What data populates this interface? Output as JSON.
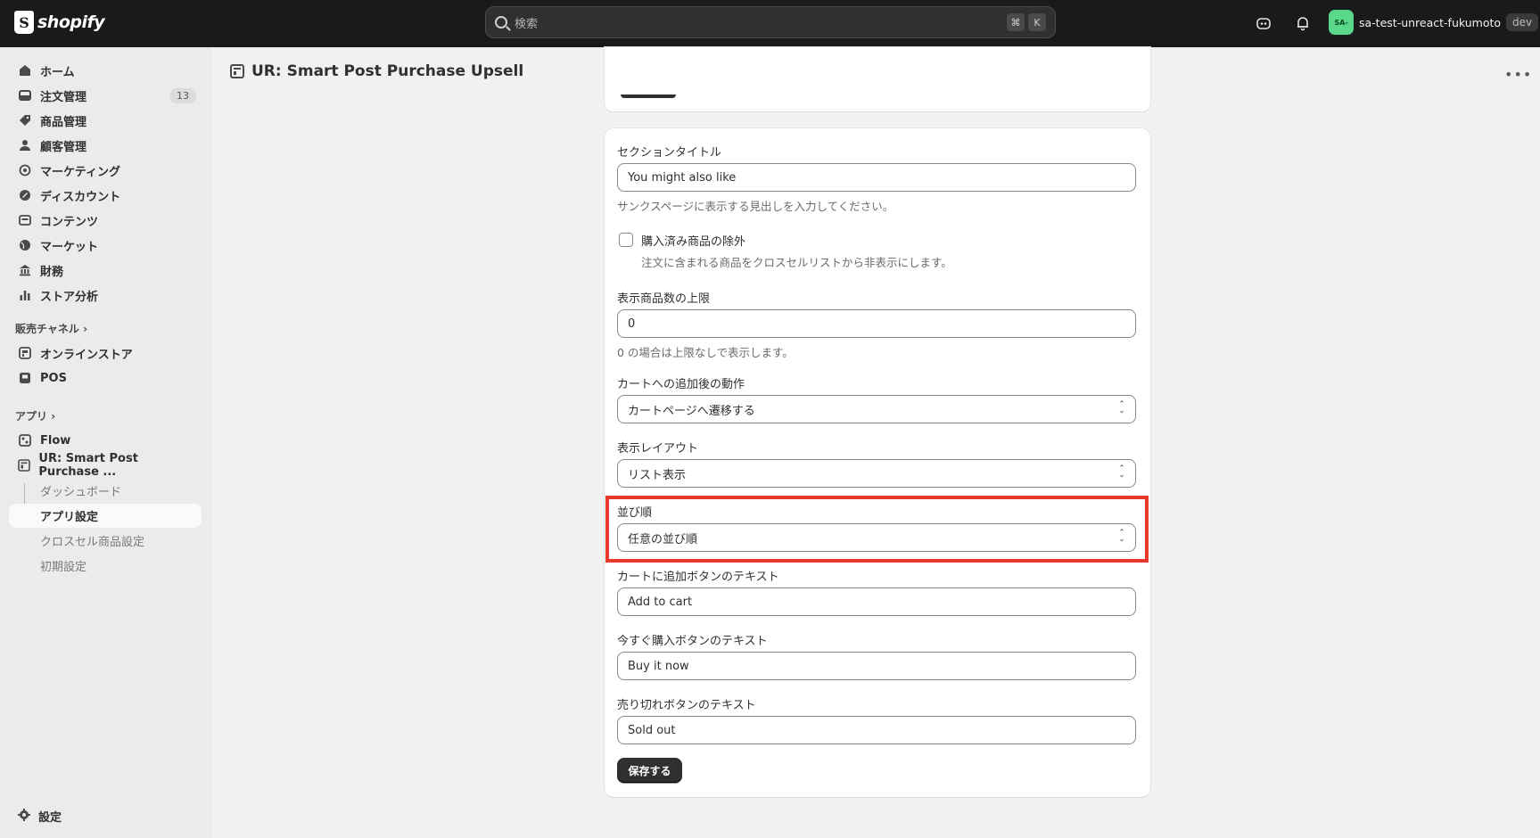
{
  "topbar": {
    "logo_text": "shopify",
    "search_placeholder": "検索",
    "shortcut_cmd": "⌘",
    "shortcut_key": "K",
    "avatar_initials": "SA-",
    "account_name": "sa-test-unreact-fukumoto",
    "account_badge": "dev"
  },
  "sidebar": {
    "items": [
      {
        "label": "ホーム",
        "icon": "home-icon"
      },
      {
        "label": "注文管理",
        "icon": "inbox-icon",
        "badge": "13"
      },
      {
        "label": "商品管理",
        "icon": "tag-icon"
      },
      {
        "label": "顧客管理",
        "icon": "person-icon"
      },
      {
        "label": "マーケティング",
        "icon": "target-icon"
      },
      {
        "label": "ディスカウント",
        "icon": "discount-icon"
      },
      {
        "label": "コンテンツ",
        "icon": "content-icon"
      },
      {
        "label": "マーケット",
        "icon": "globe-icon"
      },
      {
        "label": "財務",
        "icon": "bank-icon"
      },
      {
        "label": "ストア分析",
        "icon": "chart-icon"
      }
    ],
    "sales_channels_label": "販売チャネル",
    "channels": [
      {
        "label": "オンラインストア",
        "icon": "store-icon"
      },
      {
        "label": "POS",
        "icon": "pos-icon"
      }
    ],
    "apps_label": "アプリ",
    "apps": [
      {
        "label": "Flow",
        "icon": "flow-icon"
      },
      {
        "label": "UR: Smart Post Purchase ...",
        "icon": "app-icon"
      }
    ],
    "sub_items": [
      {
        "label": "ダッシュボード"
      },
      {
        "label": "アプリ設定"
      },
      {
        "label": "クロスセル商品設定"
      },
      {
        "label": "初期設定"
      }
    ],
    "settings_label": "設定"
  },
  "page": {
    "title": "UR: Smart Post Purchase Upsell"
  },
  "form": {
    "section_title_label": "セクションタイトル",
    "section_title_value": "You might also like",
    "section_title_help": "サンクスページに表示する見出しを入力してください。",
    "exclude_label": "購入済み商品の除外",
    "exclude_help": "注文に含まれる商品をクロスセルリストから非表示にします。",
    "limit_label": "表示商品数の上限",
    "limit_value": "0",
    "limit_help": "0 の場合は上限なしで表示します。",
    "after_add_label": "カートへの追加後の動作",
    "after_add_value": "カートページへ遷移する",
    "layout_label": "表示レイアウト",
    "layout_value": "リスト表示",
    "sort_label": "並び順",
    "sort_value": "任意の並び順",
    "add_to_cart_label": "カートに追加ボタンのテキスト",
    "add_to_cart_value": "Add to cart",
    "buy_now_label": "今すぐ購入ボタンのテキスト",
    "buy_now_value": "Buy it now",
    "sold_out_label": "売り切れボタンのテキスト",
    "sold_out_value": "Sold out",
    "save_label": "保存する"
  },
  "colors": {
    "highlight": "#e8392c",
    "topbar": "#1a1a1a",
    "avatar": "#5bd98b"
  }
}
